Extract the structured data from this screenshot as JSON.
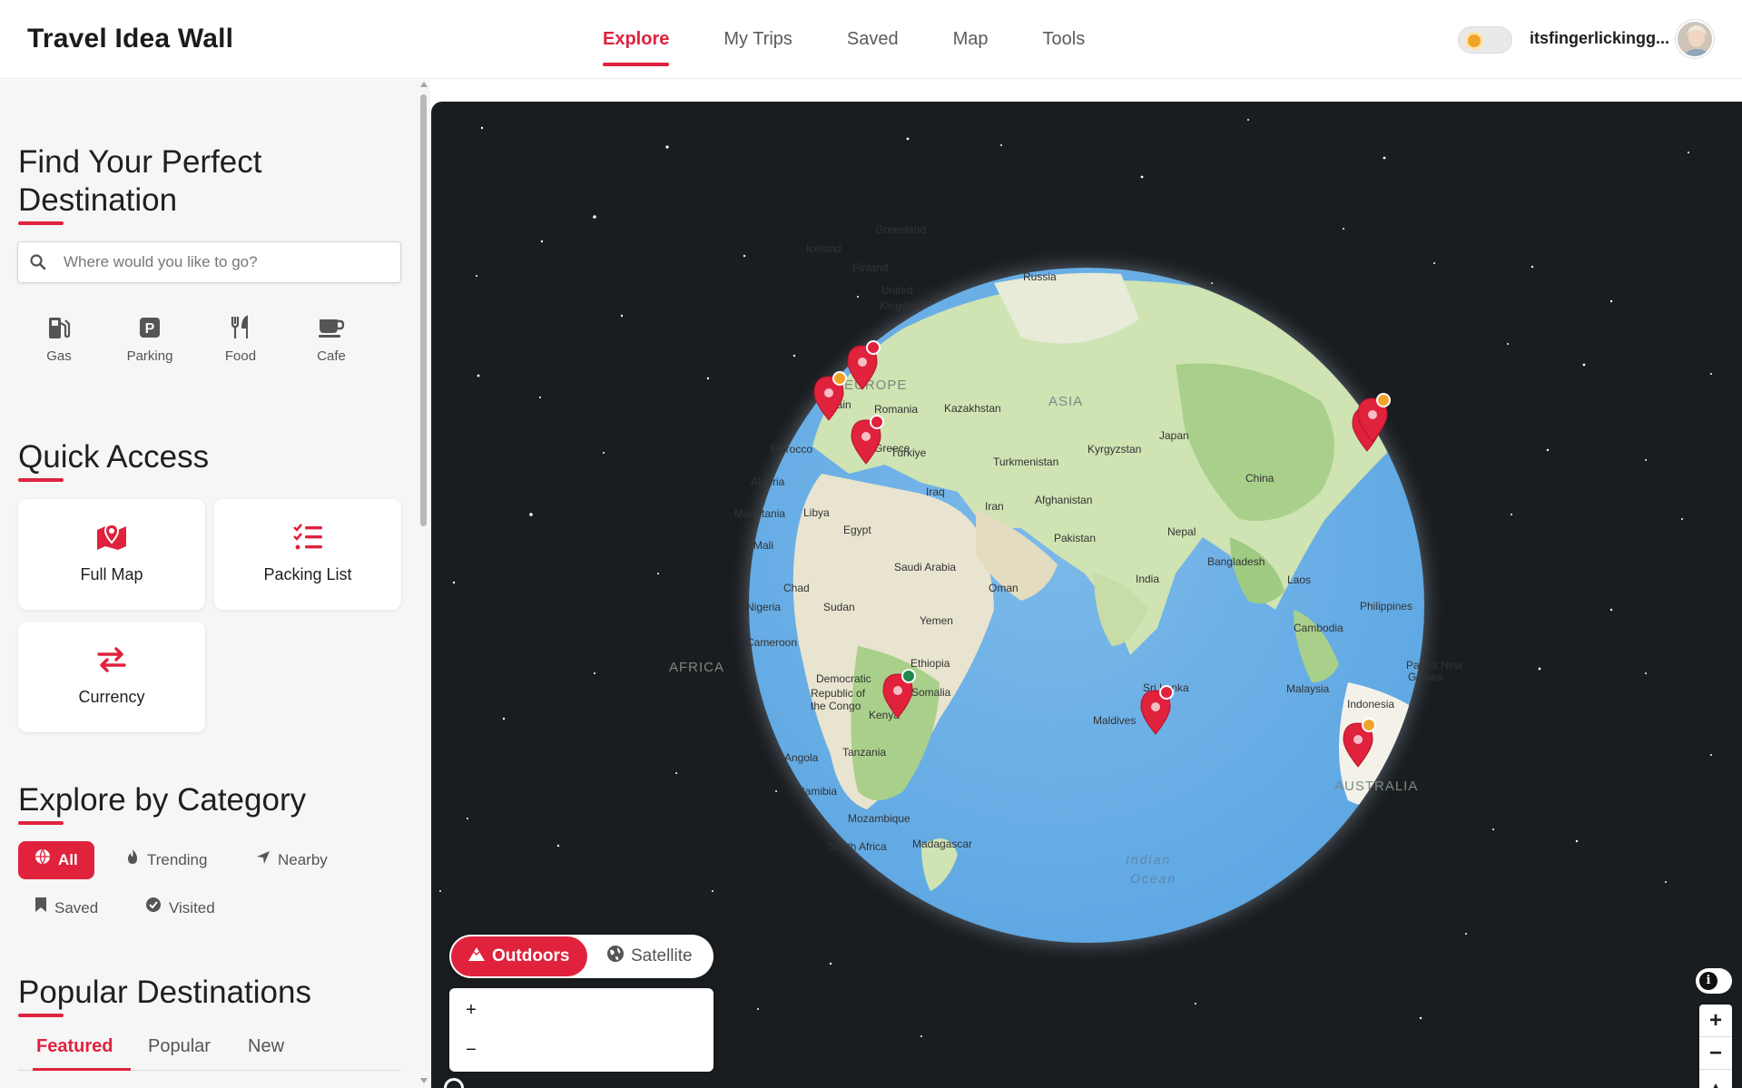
{
  "header": {
    "brand": "Travel Idea Wall",
    "nav": [
      {
        "label": "Explore",
        "active": true
      },
      {
        "label": "My Trips",
        "active": false
      },
      {
        "label": "Saved",
        "active": false
      },
      {
        "label": "Map",
        "active": false
      },
      {
        "label": "Tools",
        "active": false
      }
    ],
    "username": "itsfingerlickingg..."
  },
  "sidebar": {
    "find_title_line1": "Find Your Perfect",
    "find_title_line2": "Destination",
    "search_placeholder": "Where would you like to go?",
    "poi": [
      {
        "label": "Gas",
        "icon": "gas-pump-icon"
      },
      {
        "label": "Parking",
        "icon": "parking-icon"
      },
      {
        "label": "Food",
        "icon": "fork-knife-icon"
      },
      {
        "label": "Cafe",
        "icon": "coffee-cup-icon"
      }
    ],
    "quick_access_title": "Quick Access",
    "quick_access": [
      {
        "label": "Full Map",
        "icon": "map-pin-icon"
      },
      {
        "label": "Packing List",
        "icon": "checklist-icon"
      },
      {
        "label": "Currency",
        "icon": "exchange-arrows-icon"
      }
    ],
    "category_title": "Explore by Category",
    "categories": [
      {
        "label": "All",
        "icon": "globe-icon",
        "active": true
      },
      {
        "label": "Trending",
        "icon": "fire-icon",
        "active": false
      },
      {
        "label": "Nearby",
        "icon": "location-arrow-icon",
        "active": false
      },
      {
        "label": "Saved",
        "icon": "bookmark-icon",
        "active": false
      },
      {
        "label": "Visited",
        "icon": "check-circle-icon",
        "active": false
      }
    ],
    "popular_title": "Popular Destinations",
    "tabs": [
      {
        "label": "Featured",
        "active": true
      },
      {
        "label": "Popular",
        "active": false
      },
      {
        "label": "New",
        "active": false
      }
    ]
  },
  "map": {
    "style_buttons": [
      {
        "label": "Outdoors",
        "icon": "mountain-icon",
        "active": true
      },
      {
        "label": "Satellite",
        "icon": "globe-icon",
        "active": false
      }
    ],
    "zoom_in": "+",
    "zoom_out": "−",
    "right_zoom_in": "+",
    "right_zoom_out": "−",
    "attribution_icon": "i",
    "regions": [
      "EUROPE",
      "ASIA",
      "AFRICA",
      "AUSTRALIA"
    ],
    "ocean_line1": "Indian",
    "ocean_line2": "Ocean",
    "place_labels": [
      "Greenland",
      "Iceland",
      "Finland",
      "Russia",
      "United",
      "Kingdom",
      "Spain",
      "Romania",
      "Kazakhstan",
      "Türkiye",
      "Greece",
      "Morocco",
      "Turkmenistan",
      "Kyrgyzstan",
      "Japan",
      "Algeria",
      "Iraq",
      "Iran",
      "Afghanistan",
      "China",
      "Mauritania",
      "Libya",
      "Egypt",
      "Pakistan",
      "Nepal",
      "Mali",
      "Saudi Arabia",
      "Bangladesh",
      "India",
      "Oman",
      "Chad",
      "Sudan",
      "Laos",
      "Philippines",
      "Nigeria",
      "Yemen",
      "Cambodia",
      "Cameroon",
      "Ethiopia",
      "Papua New",
      "Guinea",
      "Democratic",
      "Republic of",
      "the Congo",
      "Somalia",
      "Sri Lanka",
      "Malaysia",
      "Kenya",
      "Indonesia",
      "Maldives",
      "Angola",
      "Tanzania",
      "Namibia",
      "Mozambique",
      "South Africa",
      "Madagascar"
    ],
    "accent": "#e0223d"
  }
}
